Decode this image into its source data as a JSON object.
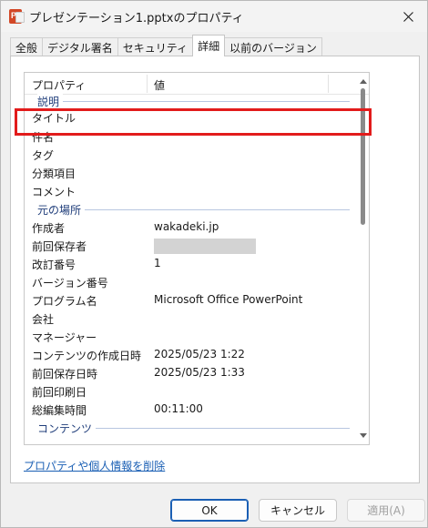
{
  "window": {
    "title": "プレゼンテーション1.pptxのプロパティ"
  },
  "tabs": [
    {
      "label": "全般"
    },
    {
      "label": "デジタル署名"
    },
    {
      "label": "セキュリティ"
    },
    {
      "label": "詳細",
      "active": true
    },
    {
      "label": "以前のバージョン"
    }
  ],
  "list": {
    "headers": {
      "property": "プロパティ",
      "value": "値"
    },
    "groups": {
      "description": "説明",
      "origin": "元の場所",
      "content": "コンテンツ"
    },
    "rows": {
      "title": {
        "key": "タイトル",
        "value": ""
      },
      "subject": {
        "key": "件名",
        "value": ""
      },
      "tags": {
        "key": "タグ",
        "value": ""
      },
      "categories": {
        "key": "分類項目",
        "value": ""
      },
      "comments": {
        "key": "コメント",
        "value": ""
      },
      "author": {
        "key": "作成者",
        "value": "wakadeki.jp"
      },
      "last_saved_by": {
        "key": "前回保存者",
        "value": ""
      },
      "revision": {
        "key": "改訂番号",
        "value": "1"
      },
      "version": {
        "key": "バージョン番号",
        "value": ""
      },
      "program": {
        "key": "プログラム名",
        "value": "Microsoft Office PowerPoint"
      },
      "company": {
        "key": "会社",
        "value": ""
      },
      "manager": {
        "key": "マネージャー",
        "value": ""
      },
      "created": {
        "key": "コンテンツの作成日時",
        "value": "2025/05/23 1:22"
      },
      "saved": {
        "key": "前回保存日時",
        "value": "2025/05/23 1:33"
      },
      "printed": {
        "key": "前回印刷日",
        "value": ""
      },
      "edit_time": {
        "key": "総編集時間",
        "value": "00:11:00"
      }
    }
  },
  "remove_link": "プロパティや個人情報を削除",
  "buttons": {
    "ok": "OK",
    "cancel": "キャンセル",
    "apply": "適用(A)"
  },
  "colors": {
    "highlight": "#e21b1b",
    "link": "#1a5fb4",
    "group_label": "#1f3d7a"
  }
}
